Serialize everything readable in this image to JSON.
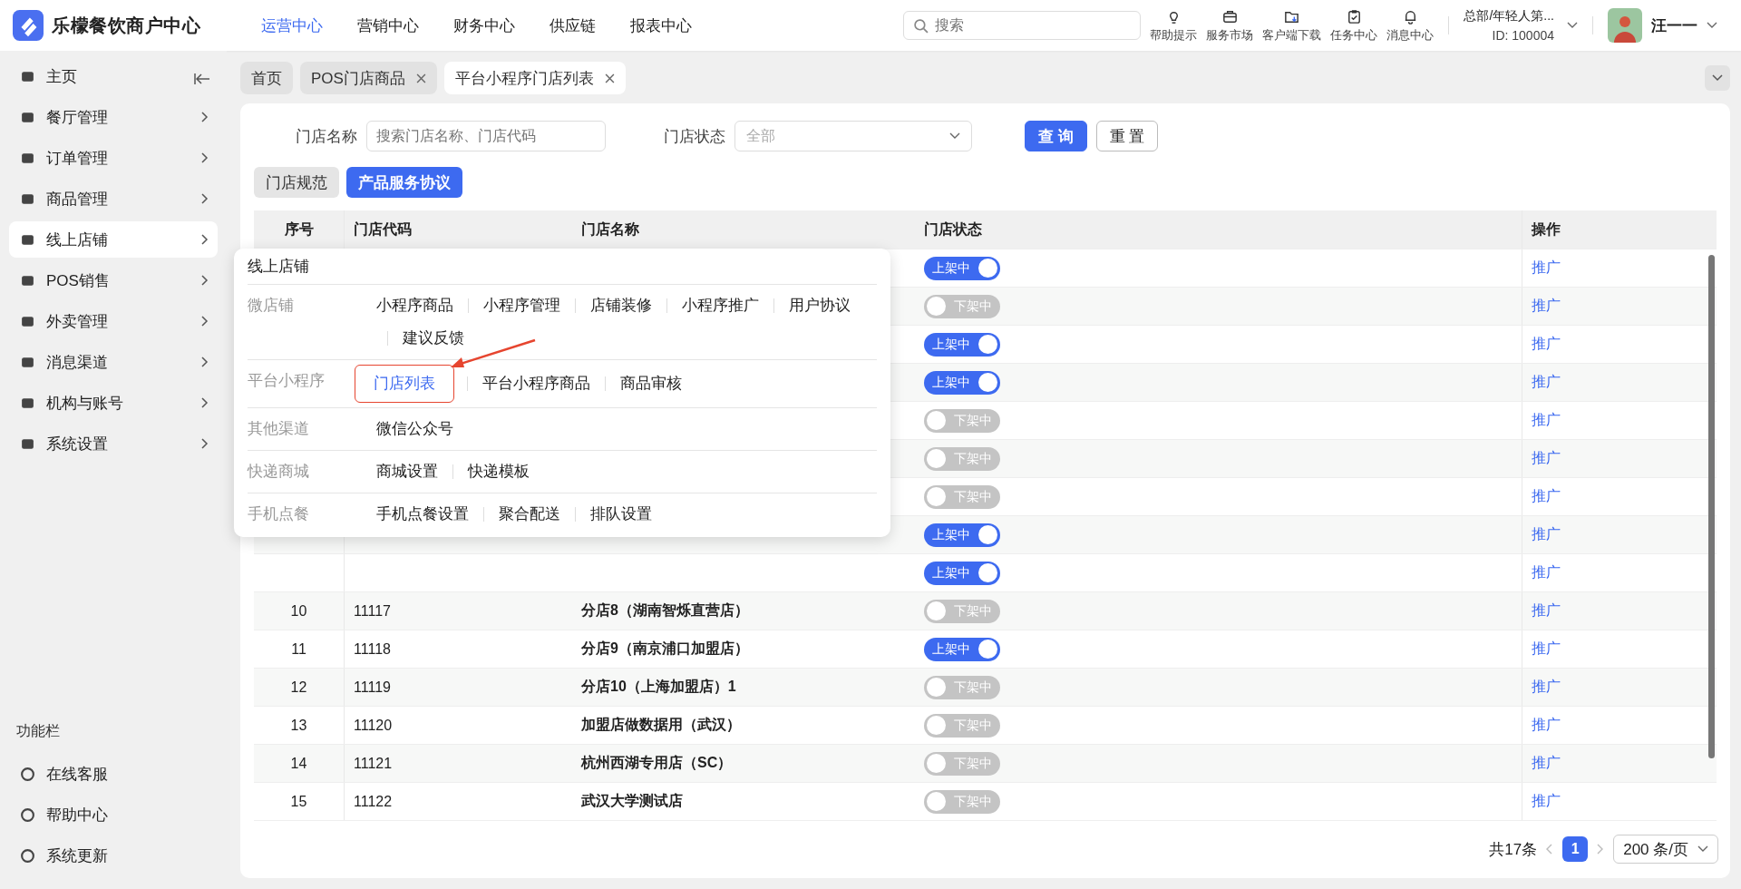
{
  "app": {
    "name": "乐檬餐饮商户中心"
  },
  "top_nav": [
    {
      "label": "运营中心",
      "selected": true
    },
    {
      "label": "营销中心",
      "selected": false
    },
    {
      "label": "财务中心",
      "selected": false
    },
    {
      "label": "供应链",
      "selected": false
    },
    {
      "label": "报表中心",
      "selected": false
    }
  ],
  "search": {
    "placeholder": "搜索"
  },
  "tools": [
    "帮助提示",
    "服务市场",
    "客户端下载",
    "任务中心",
    "消息中心"
  ],
  "org": {
    "name": "总部/年轻人第...",
    "id": "ID: 100004"
  },
  "user": {
    "name": "汪一一"
  },
  "sidebar": {
    "items": [
      {
        "label": "主页",
        "selected": false,
        "expandable": false
      },
      {
        "label": "餐厅管理",
        "selected": false,
        "expandable": true
      },
      {
        "label": "订单管理",
        "selected": false,
        "expandable": true
      },
      {
        "label": "商品管理",
        "selected": false,
        "expandable": true
      },
      {
        "label": "线上店铺",
        "selected": true,
        "expandable": true
      },
      {
        "label": "POS销售",
        "selected": false,
        "expandable": true
      },
      {
        "label": "外卖管理",
        "selected": false,
        "expandable": true
      },
      {
        "label": "消息渠道",
        "selected": false,
        "expandable": true
      },
      {
        "label": "机构与账号",
        "selected": false,
        "expandable": true
      },
      {
        "label": "系统设置",
        "selected": false,
        "expandable": true
      }
    ],
    "section_title": "功能栏",
    "footer_items": [
      "在线客服",
      "帮助中心",
      "系统更新"
    ]
  },
  "tabs": [
    {
      "label": "首页",
      "closable": false,
      "selected": false
    },
    {
      "label": "POS门店商品",
      "closable": true,
      "selected": false
    },
    {
      "label": "平台小程序门店列表",
      "closable": true,
      "selected": true
    }
  ],
  "filters": {
    "name_label": "门店名称",
    "name_placeholder": "搜索门店名称、门店代码",
    "status_label": "门店状态",
    "status_value": "全部",
    "query": "查 询",
    "reset": "重 置"
  },
  "subtabs": [
    {
      "label": "门店规范",
      "selected": false
    },
    {
      "label": "产品服务协议",
      "selected": true
    }
  ],
  "table": {
    "columns": [
      "序号",
      "门店代码",
      "门店名称",
      "门店状态",
      "操作"
    ],
    "rows": [
      {
        "status": "上架中",
        "on": true,
        "action": "推广"
      },
      {
        "status": "下架中",
        "on": false,
        "action": "推广"
      },
      {
        "status": "上架中",
        "on": true,
        "action": "推广"
      },
      {
        "status": "上架中",
        "on": true,
        "action": "推广"
      },
      {
        "status": "下架中",
        "on": false,
        "action": "推广"
      },
      {
        "status": "下架中",
        "on": false,
        "action": "推广"
      },
      {
        "status": "下架中",
        "on": false,
        "action": "推广"
      },
      {
        "status": "上架中",
        "on": true,
        "action": "推广"
      },
      {
        "status": "上架中",
        "on": true,
        "action": "推广"
      },
      {
        "index": "10",
        "code": "11117",
        "name": "分店8（湖南智烁直营店）",
        "status": "下架中",
        "on": false,
        "action": "推广"
      },
      {
        "index": "11",
        "code": "11118",
        "name": "分店9（南京浦口加盟店）",
        "status": "上架中",
        "on": true,
        "action": "推广"
      },
      {
        "index": "12",
        "code": "11119",
        "name": "分店10（上海加盟店）1",
        "status": "下架中",
        "on": false,
        "action": "推广"
      },
      {
        "index": "13",
        "code": "11120",
        "name": "加盟店做数据用（武汉）",
        "status": "下架中",
        "on": false,
        "action": "推广"
      },
      {
        "index": "14",
        "code": "11121",
        "name": "杭州西湖专用店（SC）",
        "status": "下架中",
        "on": false,
        "action": "推广"
      },
      {
        "index": "15",
        "code": "11122",
        "name": "武汉大学测试店",
        "status": "下架中",
        "on": false,
        "action": "推广"
      }
    ]
  },
  "pagination": {
    "total": "共17条",
    "pages": [
      {
        "label": "1",
        "selected": true
      }
    ],
    "page_size": "200 条/页"
  },
  "popup": {
    "title": "线上店铺",
    "groups": [
      {
        "label": "微店铺",
        "links": [
          {
            "label": "小程序商品",
            "selected": false
          },
          {
            "label": "小程序管理",
            "selected": false
          },
          {
            "label": "店铺装修",
            "selected": false
          },
          {
            "label": "小程序推广",
            "selected": false
          },
          {
            "label": "用户协议",
            "selected": false
          },
          {
            "label": "建议反馈",
            "selected": false
          }
        ]
      },
      {
        "label": "平台小程序",
        "links": [
          {
            "label": "门店列表",
            "selected": true
          },
          {
            "label": "平台小程序商品",
            "selected": false
          },
          {
            "label": "商品审核",
            "selected": false
          }
        ]
      },
      {
        "label": "其他渠道",
        "links": [
          {
            "label": "微信公众号",
            "selected": false
          }
        ]
      },
      {
        "label": "快递商城",
        "links": [
          {
            "label": "商城设置",
            "selected": false
          },
          {
            "label": "快递模板",
            "selected": false
          }
        ]
      },
      {
        "label": "手机点餐",
        "links": [
          {
            "label": "手机点餐设置",
            "selected": false
          },
          {
            "label": "聚合配送",
            "selected": false
          },
          {
            "label": "排队设置",
            "selected": false
          }
        ]
      }
    ]
  }
}
